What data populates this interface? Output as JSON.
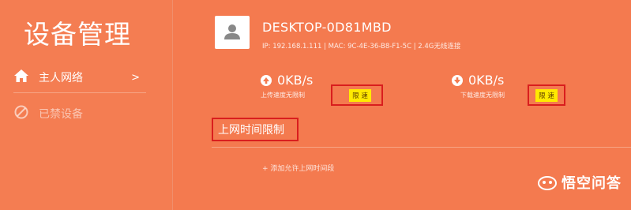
{
  "sidebar": {
    "title": "设备管理",
    "items": [
      {
        "label": "主人网络",
        "chevron": ">"
      },
      {
        "label": "已禁设备"
      }
    ]
  },
  "device": {
    "name": "DESKTOP-0D81MBD",
    "info": "IP: 192.168.1.111 | MAC: 9C-4E-36-B8-F1-5C | 2.4G无线连接"
  },
  "upload": {
    "speed": "0KB/s",
    "label": "上传速度无限制",
    "limit_button": "限 速"
  },
  "download": {
    "speed": "0KB/s",
    "label": "下载速度无限制",
    "limit_button": "限 速"
  },
  "time_limit": {
    "title": "上网时间限制",
    "add_rule": "+ 添加允许上网时间段"
  },
  "watermark": {
    "text": "悟空问答"
  },
  "colors": {
    "background": "#f47a4f",
    "highlight": "#d91e1e",
    "limit_button": "#ffea00"
  }
}
